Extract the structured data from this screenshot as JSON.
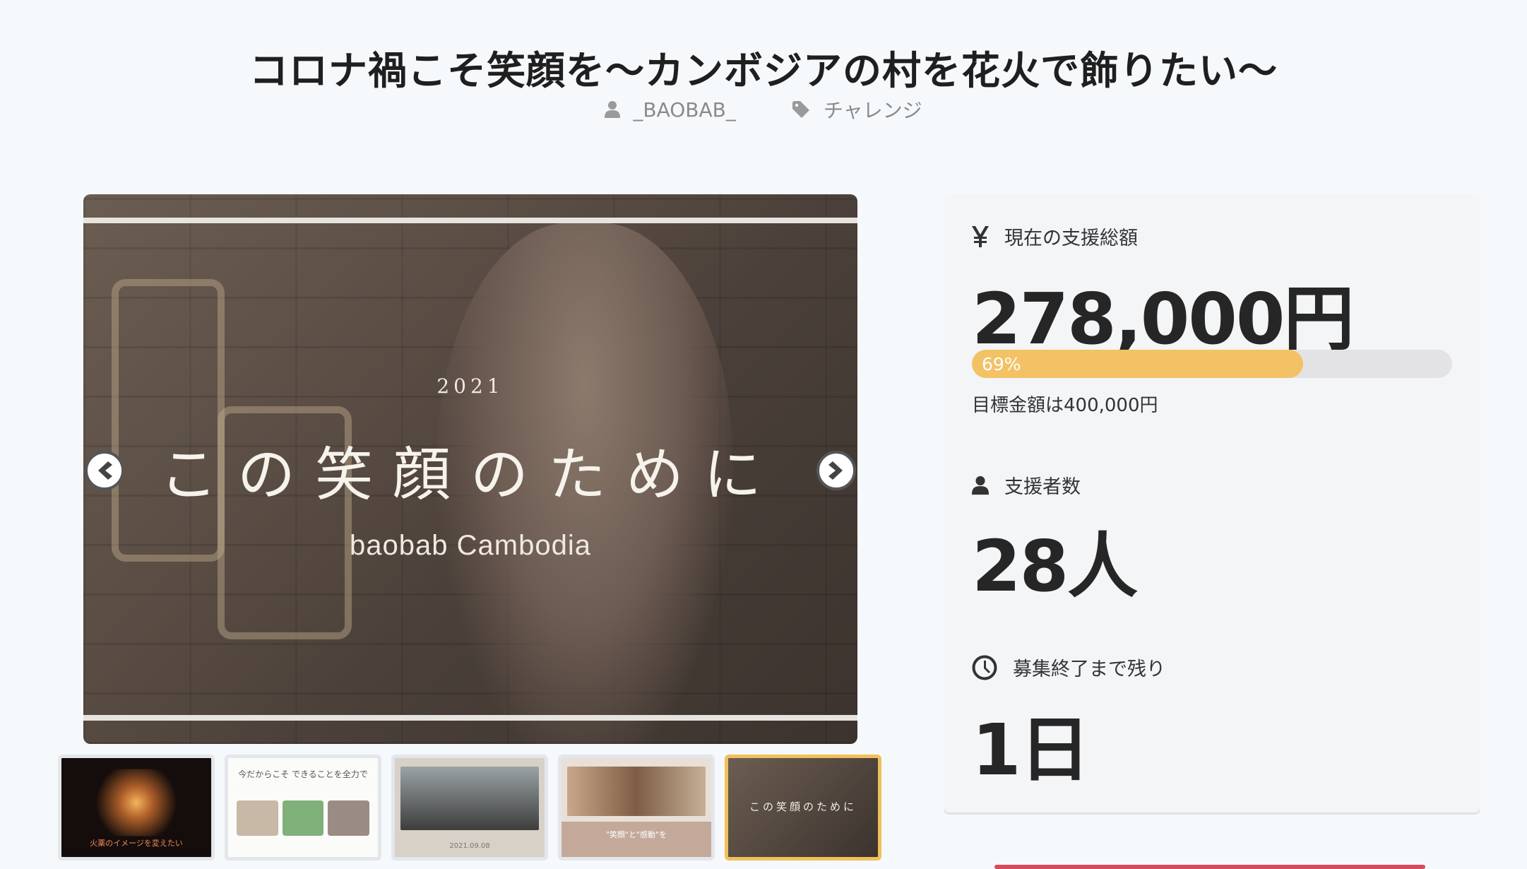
{
  "project": {
    "title": "コロナ禍こそ笑顔を〜カンボジアの村を花火で飾りたい〜",
    "author": "_BAOBAB_",
    "category": "チャレンジ",
    "author_icon": "user-icon",
    "category_icon": "tag-icon"
  },
  "slider": {
    "current_slide": {
      "year": "2021",
      "headline": "この笑顔のために",
      "subtitle": "baobab Cambodia"
    },
    "prev_icon": "chevron-left-circle-icon",
    "next_icon": "chevron-right-circle-icon",
    "thumbnails": [
      {
        "caption": "火薬のイメージを変えたい"
      },
      {
        "caption": "今だからこそ できることを全力で"
      },
      {
        "caption": "2021.09.08"
      },
      {
        "caption": "\"笑顔\"と\"感動\"を"
      },
      {
        "caption": "この笑顔のために"
      }
    ],
    "active_index": 4
  },
  "stats": {
    "amount_label": "現在の支援総額",
    "amount_value": "278,000円",
    "progress_percent": 69,
    "progress_label": "69%",
    "goal_text": "目標金額は400,000円",
    "supporters_label": "支援者数",
    "supporters_value": "28人",
    "remaining_label": "募集終了まで残り",
    "remaining_value": "1日",
    "icons": [
      "yen-icon",
      "user-icon",
      "clock-icon"
    ]
  },
  "colors": {
    "progress_fill": "#f2c265",
    "active_thumb_border": "#f0c05a",
    "background": "#f6f9fc"
  }
}
